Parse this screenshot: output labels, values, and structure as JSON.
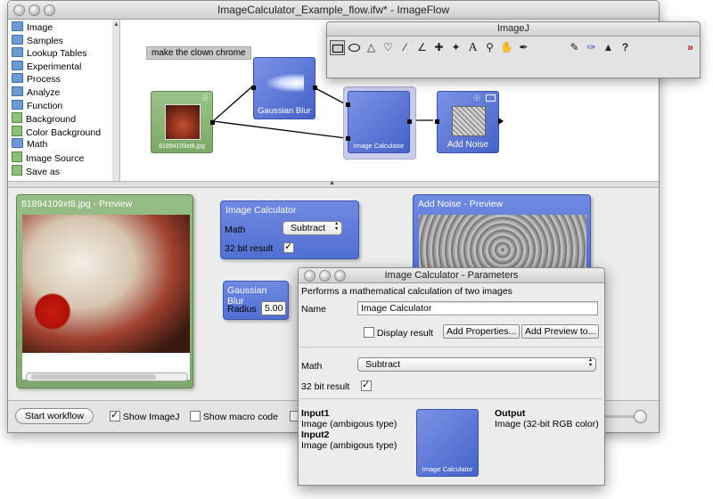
{
  "main_window": {
    "title": "ImageCalculator_Example_flow.ifw* - ImageFlow"
  },
  "sidebar": {
    "items": [
      {
        "label": "Image",
        "icon": "folder-icon"
      },
      {
        "label": "Samples",
        "icon": "folder-icon"
      },
      {
        "label": "Lookup Tables",
        "icon": "folder-icon"
      },
      {
        "label": "Experimental",
        "icon": "folder-icon"
      },
      {
        "label": "Process",
        "icon": "folder-icon"
      },
      {
        "label": "Analyze",
        "icon": "folder-icon"
      },
      {
        "label": "Function",
        "icon": "folder-icon"
      },
      {
        "label": "Background",
        "icon": "node-icon"
      },
      {
        "label": "Color Background",
        "icon": "node-icon"
      },
      {
        "label": "Math",
        "icon": "folder-icon"
      },
      {
        "label": "Image Source",
        "icon": "node-icon"
      },
      {
        "label": "Save as",
        "icon": "node-icon"
      }
    ]
  },
  "canvas": {
    "comment_note": "make the clown chrome",
    "nodes": {
      "source": {
        "label": "81894109xt8.jpg"
      },
      "gaussian": {
        "label": "Gaussian Blur"
      },
      "calculator": {
        "label": "Image Calculator"
      },
      "noise": {
        "label": "Add Noise"
      }
    }
  },
  "preview_source": {
    "title": "81894109xt8.jpg - Preview"
  },
  "calc_panel": {
    "title": "Image Calculator",
    "math_label": "Math",
    "math_value": "Subtract",
    "bit_label": "32 bit result",
    "bit_checked": true
  },
  "gauss_panel": {
    "title": "Gaussian Blur",
    "radius_label": "Radius",
    "radius_value": "5.00"
  },
  "noise_preview": {
    "title": "Add Noise - Preview"
  },
  "bottom_bar": {
    "start_button": "Start workflow",
    "show_imagej_label": "Show ImageJ",
    "show_imagej_checked": true,
    "show_macro_label": "Show macro code",
    "show_macro_checked": false
  },
  "imagej": {
    "title": "ImageJ",
    "tools": [
      "rectangle-tool-icon",
      "oval-tool-icon",
      "polygon-tool-icon",
      "freehand-tool-icon",
      "line-tool-icon",
      "angle-tool-icon",
      "point-tool-icon",
      "wand-tool-icon",
      "text-tool-icon",
      "zoom-tool-icon",
      "hand-tool-icon",
      "color-picker-icon",
      "pencil-tool-icon",
      "brush-tool-icon",
      "flood-fill-icon",
      "help-icon",
      "more-tools-icon"
    ]
  },
  "params_window": {
    "title": "Image Calculator - Parameters",
    "description": "Performs a mathematical calculation of two images",
    "name_label": "Name",
    "name_value": "Image Calculator",
    "display_result_label": "Display result",
    "display_result_checked": false,
    "add_properties_button": "Add Properties...",
    "add_preview_button": "Add Preview to...",
    "math_label": "Math",
    "math_value": "Subtract",
    "bit_label": "32 bit result",
    "bit_checked": true,
    "input1_title": "Input1",
    "input1_type": "Image (ambigous type)",
    "input2_title": "Input2",
    "input2_type": "Image (ambigous type)",
    "output_title": "Output",
    "output_type": "Image (32-bit RGB color)",
    "node_label": "Image Calculator"
  },
  "colors": {
    "node_blue": "#5470d6",
    "source_green": "#8fb77c",
    "panel_blue": "#5b78d8"
  }
}
